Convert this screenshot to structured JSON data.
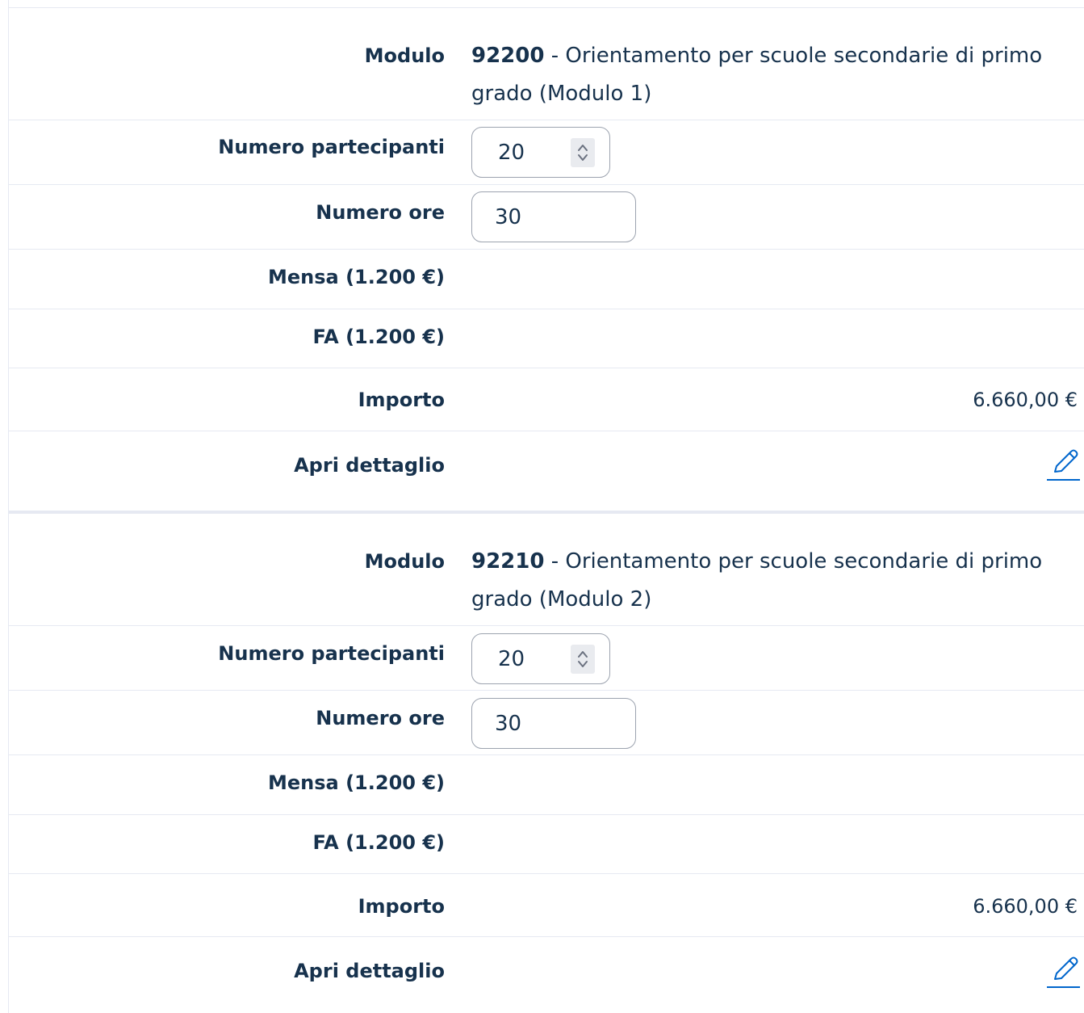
{
  "modules": [
    {
      "modulo_label": "Modulo",
      "modulo_code": "92200",
      "modulo_desc_line1": " - Orientamento per scuole secondarie di primo",
      "modulo_desc_line2": "grado (Modulo 1)",
      "partecipanti_label": "Numero partecipanti",
      "partecipanti_value": "20",
      "ore_label": "Numero ore",
      "ore_value": "30",
      "mensa_label": "Mensa (1.200 €)",
      "fa_label": "FA (1.200 €)",
      "importo_label": "Importo",
      "importo_value": "6.660,00 €",
      "dettaglio_label": "Apri dettaglio",
      "dettaglio_icon": "pencil-icon"
    },
    {
      "modulo_label": "Modulo",
      "modulo_code": "92210",
      "modulo_desc_line1": " - Orientamento per scuole secondarie di primo",
      "modulo_desc_line2": "grado (Modulo 2)",
      "partecipanti_label": "Numero partecipanti",
      "partecipanti_value": "20",
      "ore_label": "Numero ore",
      "ore_value": "30",
      "mensa_label": "Mensa (1.200 €)",
      "fa_label": "FA (1.200 €)",
      "importo_label": "Importo",
      "importo_value": "6.660,00 €",
      "dettaglio_label": "Apri dettaglio",
      "dettaglio_icon": "pencil-icon"
    }
  ],
  "colors": {
    "text": "#17324d",
    "link": "#0066cc",
    "border": "#e6e9f2"
  }
}
